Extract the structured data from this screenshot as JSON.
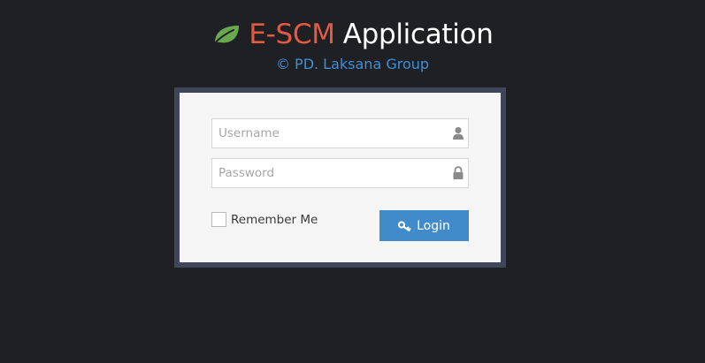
{
  "header": {
    "title_accent": "E-SCM",
    "title_main": "Application",
    "subtitle": "© PD. Laksana Group",
    "logo_icon": "leaf-icon"
  },
  "login": {
    "username_placeholder": "Username",
    "username_value": "",
    "username_icon": "user-icon",
    "password_placeholder": "Password",
    "password_value": "",
    "password_icon": "lock-icon",
    "remember_label": "Remember Me",
    "remember_checked": false,
    "login_button_label": "Login",
    "login_button_icon": "key-icon"
  },
  "colors": {
    "background": "#1f2024",
    "accent_red": "#e25a43",
    "subtitle_blue": "#3d8fd8",
    "leaf_green": "#6aa84f",
    "frame_border": "#40465a",
    "button_blue": "#428bca"
  }
}
